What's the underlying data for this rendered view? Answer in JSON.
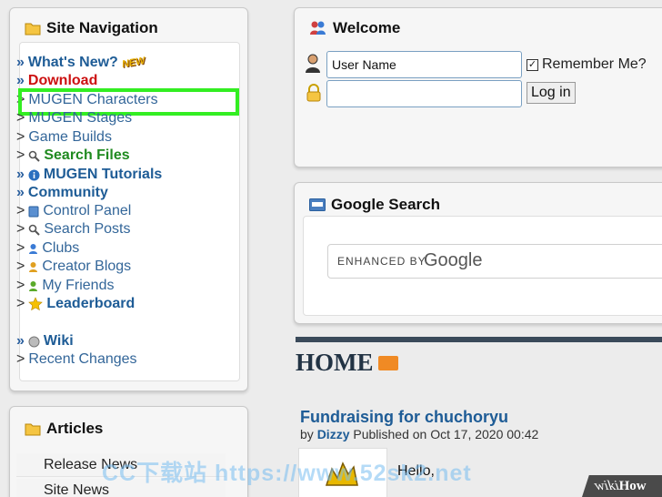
{
  "nav": {
    "title": "Site Navigation",
    "items": [
      {
        "prefix": "»",
        "label": "What's New?",
        "badge": "NEW"
      },
      {
        "prefix": "»",
        "label": "Download"
      },
      {
        "prefix": ">",
        "label": "MUGEN Characters"
      },
      {
        "prefix": ">",
        "label": "MUGEN Stages"
      },
      {
        "prefix": ">",
        "label": "Game Builds"
      },
      {
        "prefix": ">",
        "label": "Search Files"
      },
      {
        "prefix": "»",
        "label": "MUGEN Tutorials"
      },
      {
        "prefix": "»",
        "label": "Community"
      },
      {
        "prefix": ">",
        "label": "Control Panel"
      },
      {
        "prefix": ">",
        "label": "Search Posts"
      },
      {
        "prefix": ">",
        "label": "Clubs"
      },
      {
        "prefix": ">",
        "label": "Creator Blogs"
      },
      {
        "prefix": ">",
        "label": "My Friends"
      },
      {
        "prefix": ">",
        "label": "Leaderboard"
      },
      {
        "prefix": "»",
        "label": "Wiki"
      },
      {
        "prefix": ">",
        "label": "Recent Changes"
      }
    ]
  },
  "articles": {
    "title": "Articles",
    "items": [
      "Release News",
      "Site News"
    ]
  },
  "welcome": {
    "title": "Welcome",
    "username_value": "User Name",
    "password_value": "",
    "remember_label": "Remember Me?",
    "remember_checked": true,
    "login_label": "Log in"
  },
  "google": {
    "title": "Google Search",
    "enhanced_by": "ENHANCED BY",
    "logo_text": "Google"
  },
  "home": {
    "title": "HOME",
    "article_title": "Fundraising for chuchoryu",
    "by": "by",
    "author": "Dizzy",
    "published": "Published on Oct 17, 2020 00:42",
    "body_start": "Hello,"
  },
  "watermark": "CC下载站 https://www.52sk2.net",
  "wikihow": {
    "wiki": "wiki",
    "how": "How"
  },
  "colors": {
    "highlight": "#33ee22",
    "link": "#336699",
    "download": "#cc1111",
    "search_files": "#1f8a1f"
  }
}
